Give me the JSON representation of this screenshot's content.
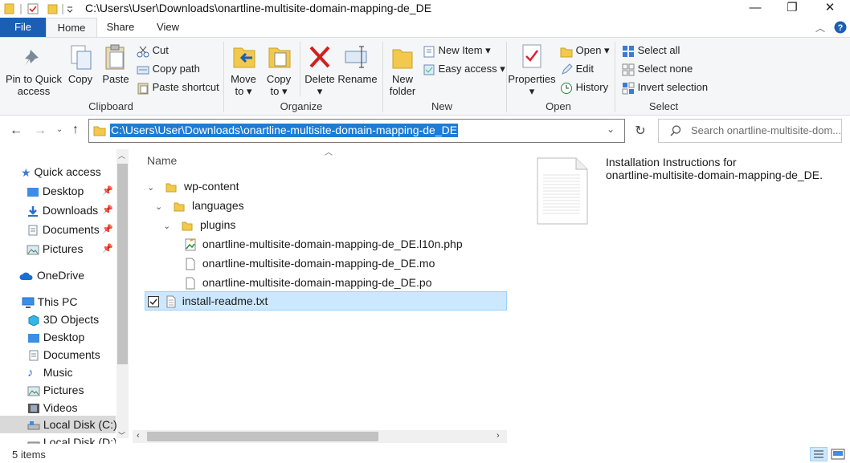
{
  "window": {
    "title": "C:\\Users\\User\\Downloads\\onartline-multisite-domain-mapping-de_DE",
    "minimize": "—",
    "maximize": "❐",
    "close": "✕"
  },
  "tabs": [
    "File",
    "Home",
    "Share",
    "View"
  ],
  "ribbon": {
    "clipboard": {
      "label": "Clipboard",
      "pin": "Pin to Quick\naccess",
      "copy": "Copy",
      "paste": "Paste",
      "cut": "Cut",
      "copy_path": "Copy path",
      "paste_shortcut": "Paste shortcut"
    },
    "organize": {
      "label": "Organize",
      "move_to": "Move\nto ▾",
      "copy_to": "Copy\nto ▾",
      "delete": "Delete\n▾",
      "rename": "Rename"
    },
    "new": {
      "label": "New",
      "new_folder": "New\nfolder",
      "new_item": "New Item ▾",
      "easy_access": "Easy access ▾"
    },
    "open": {
      "label": "Open",
      "properties": "Properties\n▾",
      "open": "Open ▾",
      "edit": "Edit",
      "history": "History"
    },
    "select": {
      "label": "Select",
      "select_all": "Select all",
      "select_none": "Select none",
      "invert": "Invert selection"
    }
  },
  "address": {
    "path": "C:\\Users\\User\\Downloads\\onartline-multisite-domain-mapping-de_DE",
    "search_placeholder": "Search onartline-multisite-dom..."
  },
  "nav": {
    "quick_access": "Quick access",
    "quick_items": [
      "Desktop",
      "Downloads",
      "Documents",
      "Pictures"
    ],
    "onedrive": "OneDrive",
    "this_pc": "This PC",
    "pc_items": [
      "3D Objects",
      "Desktop",
      "Documents",
      "Music",
      "Pictures",
      "Videos",
      "Local Disk (C:)",
      "Local Disk (D:)"
    ]
  },
  "filelist": {
    "column": "Name",
    "items": [
      {
        "name": "wp-content",
        "type": "folder"
      },
      {
        "name": "languages",
        "type": "folder"
      },
      {
        "name": "plugins",
        "type": "folder"
      },
      {
        "name": "onartline-multisite-domain-mapping-de_DE.l10n.php",
        "type": "php"
      },
      {
        "name": "onartline-multisite-domain-mapping-de_DE.mo",
        "type": "file"
      },
      {
        "name": "onartline-multisite-domain-mapping-de_DE.po",
        "type": "file"
      },
      {
        "name": "install-readme.txt",
        "type": "txt",
        "selected": true
      }
    ]
  },
  "preview": {
    "line1": "Installation Instructions for",
    "line2": "onartline-multisite-domain-mapping-de_DE."
  },
  "status": {
    "items": "5 items"
  },
  "colors": {
    "file_tab": "#1a5fb4",
    "selection": "#cce8ff",
    "address_highlight": "#1c7cd6",
    "folder": "#f2c94c"
  }
}
